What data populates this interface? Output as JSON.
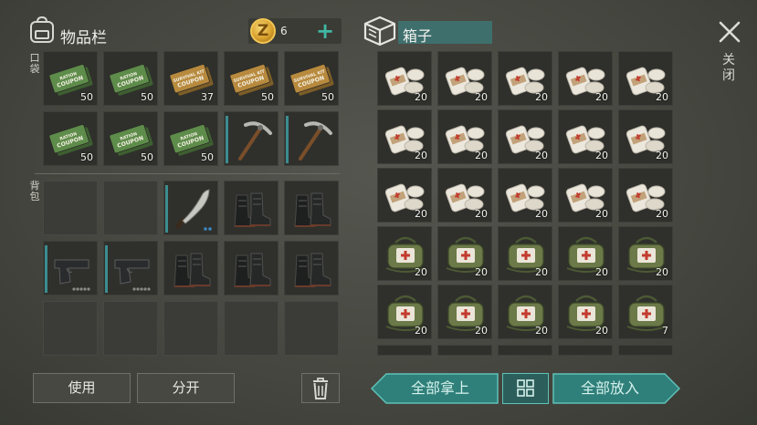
{
  "inventory": {
    "title": "物品栏",
    "pockets_label": "口袋",
    "backpack_label": "背包",
    "coins": "6",
    "add_label": "+",
    "pockets": [
      {
        "item": "ration-coupon",
        "count": "50"
      },
      {
        "item": "ration-coupon",
        "count": "50"
      },
      {
        "item": "survival-kit-coupon",
        "count": "37"
      },
      {
        "item": "survival-kit-coupon",
        "count": "50"
      },
      {
        "item": "survival-kit-coupon",
        "count": "50"
      },
      {
        "item": "green-coupon",
        "count": "50"
      },
      {
        "item": "ration-coupon",
        "count": "50"
      },
      {
        "item": "green-coupon",
        "count": "50"
      },
      {
        "item": "pickaxe",
        "count": ""
      },
      {
        "item": "pickaxe",
        "count": ""
      }
    ],
    "backpack": [
      {
        "item": "empty"
      },
      {
        "item": "empty"
      },
      {
        "item": "machete"
      },
      {
        "item": "boots"
      },
      {
        "item": "boots"
      },
      {
        "item": "pistol"
      },
      {
        "item": "pistol"
      },
      {
        "item": "boots"
      },
      {
        "item": "boots"
      },
      {
        "item": "boots"
      },
      {
        "item": "empty"
      },
      {
        "item": "empty"
      },
      {
        "item": "empty"
      },
      {
        "item": "empty"
      },
      {
        "item": "empty"
      }
    ],
    "use_label": "使用",
    "split_label": "分开"
  },
  "coupon_text": {
    "ration": [
      "RATION",
      "COUPON"
    ],
    "survival": [
      "SURVIVAL KIT",
      "COUPON"
    ],
    "green": [
      "RATION",
      "COUPON"
    ]
  },
  "box": {
    "title": "箱子",
    "slots": [
      {
        "item": "bandage",
        "count": "20"
      },
      {
        "item": "bandage",
        "count": "20"
      },
      {
        "item": "bandage",
        "count": "20"
      },
      {
        "item": "bandage",
        "count": "20"
      },
      {
        "item": "bandage",
        "count": "20"
      },
      {
        "item": "bandage",
        "count": "20"
      },
      {
        "item": "bandage",
        "count": "20"
      },
      {
        "item": "bandage",
        "count": "20"
      },
      {
        "item": "bandage",
        "count": "20"
      },
      {
        "item": "bandage",
        "count": "20"
      },
      {
        "item": "bandage",
        "count": "20"
      },
      {
        "item": "bandage",
        "count": "20"
      },
      {
        "item": "bandage",
        "count": "20"
      },
      {
        "item": "bandage",
        "count": "20"
      },
      {
        "item": "bandage",
        "count": "20"
      },
      {
        "item": "medkit",
        "count": "20"
      },
      {
        "item": "medkit",
        "count": "20"
      },
      {
        "item": "medkit",
        "count": "20"
      },
      {
        "item": "medkit",
        "count": "20"
      },
      {
        "item": "medkit",
        "count": "20"
      },
      {
        "item": "medkit",
        "count": "20"
      },
      {
        "item": "medkit",
        "count": "20"
      },
      {
        "item": "medkit",
        "count": "20"
      },
      {
        "item": "medkit",
        "count": "20"
      },
      {
        "item": "medkit",
        "count": "7"
      }
    ],
    "take_all_label": "全部拿上",
    "put_all_label": "全部放入"
  },
  "close_label": "关闭",
  "colors": {
    "teal": "#3fb8a4",
    "teal_button": "#2f7f7a",
    "durability": "#3c8c90"
  }
}
